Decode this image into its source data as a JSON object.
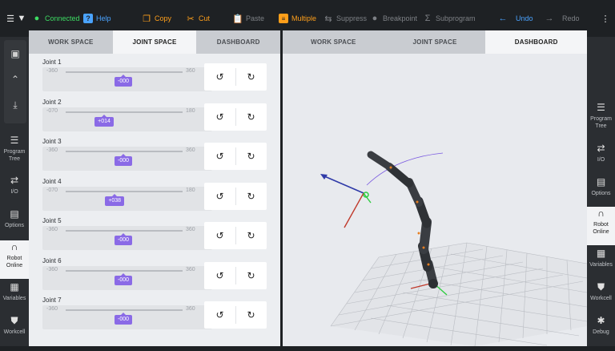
{
  "toolbar": {
    "connected_label": "Connected",
    "help_label": "Help",
    "copy_label": "Copy",
    "cut_label": "Cut",
    "paste_label": "Paste",
    "multiple_label": "Multiple",
    "suppress_label": "Suppress",
    "breakpoint_label": "Breakpoint",
    "subprogram_label": "Subprogram",
    "undo_label": "Undo",
    "redo_label": "Redo"
  },
  "left_panel": {
    "tabs": [
      {
        "label": "WORK SPACE",
        "active": false
      },
      {
        "label": "JOINT SPACE",
        "active": true
      },
      {
        "label": "DASHBOARD",
        "active": false
      }
    ],
    "joints": [
      {
        "label": "Joint 1",
        "min": "-360",
        "max": "360",
        "value": "-000",
        "level": 0.5
      },
      {
        "label": "Joint 2",
        "min": "-070",
        "max": "180",
        "value": "+014",
        "level": 0.33
      },
      {
        "label": "Joint 3",
        "min": "-360",
        "max": "360",
        "value": "-000",
        "level": 0.5
      },
      {
        "label": "Joint 4",
        "min": "-070",
        "max": "180",
        "value": "+038",
        "level": 0.42
      },
      {
        "label": "Joint 5",
        "min": "-360",
        "max": "360",
        "value": "-000",
        "level": 0.5
      },
      {
        "label": "Joint 6",
        "min": "-360",
        "max": "360",
        "value": "-000",
        "level": 0.5
      },
      {
        "label": "Joint 7",
        "min": "-360",
        "max": "360",
        "value": "-000",
        "level": 0.5
      }
    ]
  },
  "right_panel": {
    "tabs": [
      {
        "label": "WORK SPACE",
        "active": false
      },
      {
        "label": "JOINT SPACE",
        "active": false
      },
      {
        "label": "DASHBOARD",
        "active": true
      }
    ]
  },
  "left_rail": {
    "items": [
      {
        "label": "Program Tree",
        "icon": "list-icon"
      },
      {
        "label": "I/O",
        "icon": "io-icon"
      },
      {
        "label": "Options",
        "icon": "clipboard-icon"
      },
      {
        "label": "Robot Online",
        "icon": "robot-arm-icon",
        "active": true
      },
      {
        "label": "Variables",
        "icon": "briefcase-icon"
      },
      {
        "label": "Workcell",
        "icon": "shield-icon"
      }
    ]
  },
  "right_rail": {
    "items": [
      {
        "label": "Program Tree",
        "icon": "list-icon"
      },
      {
        "label": "I/O",
        "icon": "io-icon"
      },
      {
        "label": "Options",
        "icon": "clipboard-icon"
      },
      {
        "label": "Robot Online",
        "icon": "robot-arm-icon",
        "active": true
      },
      {
        "label": "Variables",
        "icon": "briefcase-icon"
      },
      {
        "label": "Workcell",
        "icon": "shield-icon"
      },
      {
        "label": "Debug",
        "icon": "bug-icon"
      }
    ]
  },
  "colors": {
    "accent_purple": "#8a6ae6",
    "connected_green": "#3ddc63",
    "multiple_orange": "#ff9f1a",
    "undo_blue": "#4aa3ff"
  }
}
